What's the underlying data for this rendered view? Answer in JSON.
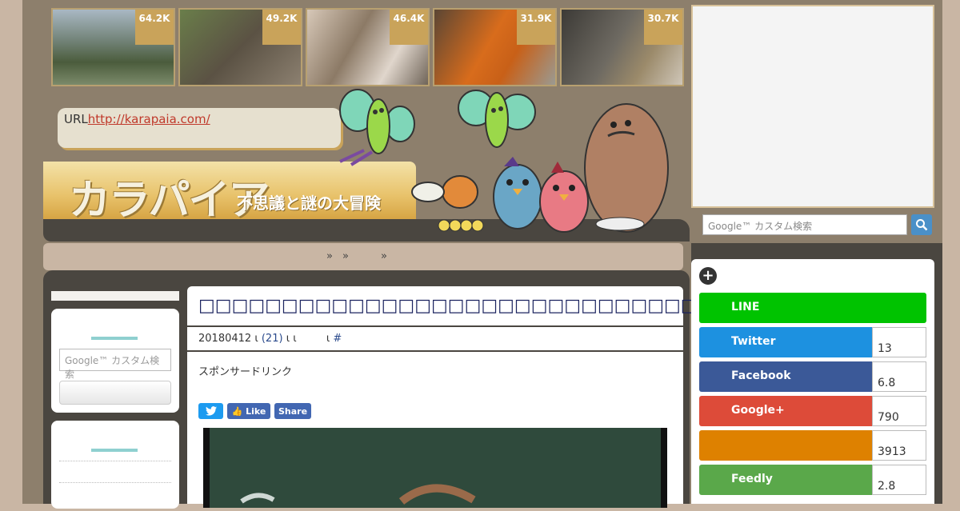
{
  "thumbnails": [
    {
      "count": "64.2K"
    },
    {
      "count": "49.2K"
    },
    {
      "count": "46.4K"
    },
    {
      "count": "31.9K"
    },
    {
      "count": "30.7K"
    }
  ],
  "header": {
    "url_label": "URL",
    "url_link": "http://karapaia.com/",
    "logo": "カラパイア",
    "tagline": "不思議と謎の大冒険"
  },
  "nav": {
    "sep1": "»",
    "sep2": "»",
    "sep3": "»"
  },
  "left_sidebar": {
    "search_placeholder": "Google™ カスタム検索"
  },
  "article": {
    "title": "□□□□□□□□□□□□□□□□□□□□□□□□□□□□□□□□□□□□□□□□□□",
    "date": "20180412",
    "sep_a": "ι",
    "comments": "(21)",
    "sep_b": "ι ι",
    "sep_c": "ι",
    "hash": "#",
    "sponsor": "スポンサードリンク",
    "share_buttons": {
      "like": "Like",
      "share": "Share"
    }
  },
  "right_sidebar": {
    "search_placeholder": "Google™ カスタム検索",
    "share_rows": [
      {
        "label": "LINE",
        "count": "",
        "color": "#00c300"
      },
      {
        "label": "Twitter",
        "count": "13",
        "color": "#1d91e0"
      },
      {
        "label": "Facebook",
        "count": "6.8",
        "color": "#3b5998"
      },
      {
        "label": "Google+",
        "count": "790",
        "color": "#dd4b39"
      },
      {
        "label": "",
        "count": "3913",
        "color": "#de8100"
      },
      {
        "label": "Feedly",
        "count": "2.8",
        "color": "#5aa84a"
      }
    ]
  },
  "colors": {
    "accent": "#c9a35a",
    "title": "#1c2460",
    "dark": "#4a4640"
  }
}
